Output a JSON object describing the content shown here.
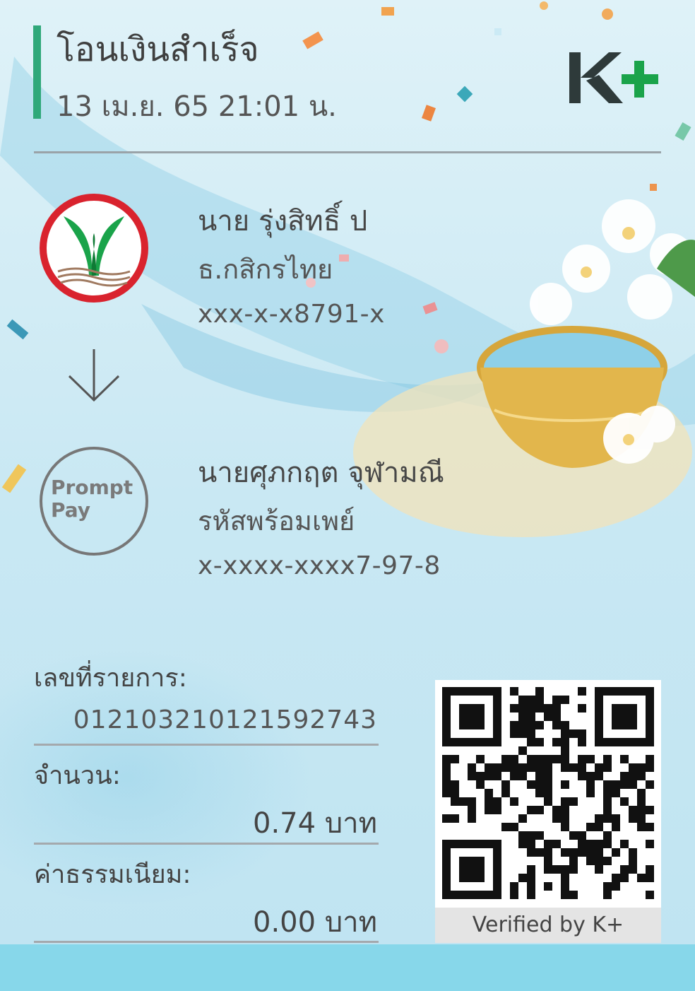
{
  "header": {
    "title": "โอนเงินสำเร็จ",
    "datetime": "13 เม.ย. 65  21:01 น.",
    "logo_text": "K+"
  },
  "sender": {
    "name": "นาย รุ่งสิทธิ์ ป",
    "bank": "ธ.กสิกรไทย",
    "account": "xxx-x-x8791-x"
  },
  "receiver": {
    "logo_line1": "Prompt",
    "logo_line2": "Pay",
    "name": "นายศุภกฤต จุฬามณี",
    "channel": "รหัสพร้อมเพย์",
    "account": "x-xxxx-xxxx7-97-8"
  },
  "details": {
    "ref_label": "เลขที่รายการ:",
    "ref_value": "012103210121592743",
    "amount_label": "จำนวน:",
    "amount_value": "0.74 บาท",
    "fee_label": "ค่าธรรมเนียม:",
    "fee_value": "0.00 บาท"
  },
  "qr": {
    "caption": "Verified by K+"
  },
  "colors": {
    "accent_green": "#2fa87a",
    "kbank_green": "#1aa34a",
    "kbank_red": "#d9232e",
    "bottom_band": "#87d7ea"
  },
  "icons": {
    "bank_logo": "kasikorn-bank-icon",
    "transfer_arrow": "down-arrow-icon",
    "promptpay_logo": "promptpay-icon"
  }
}
